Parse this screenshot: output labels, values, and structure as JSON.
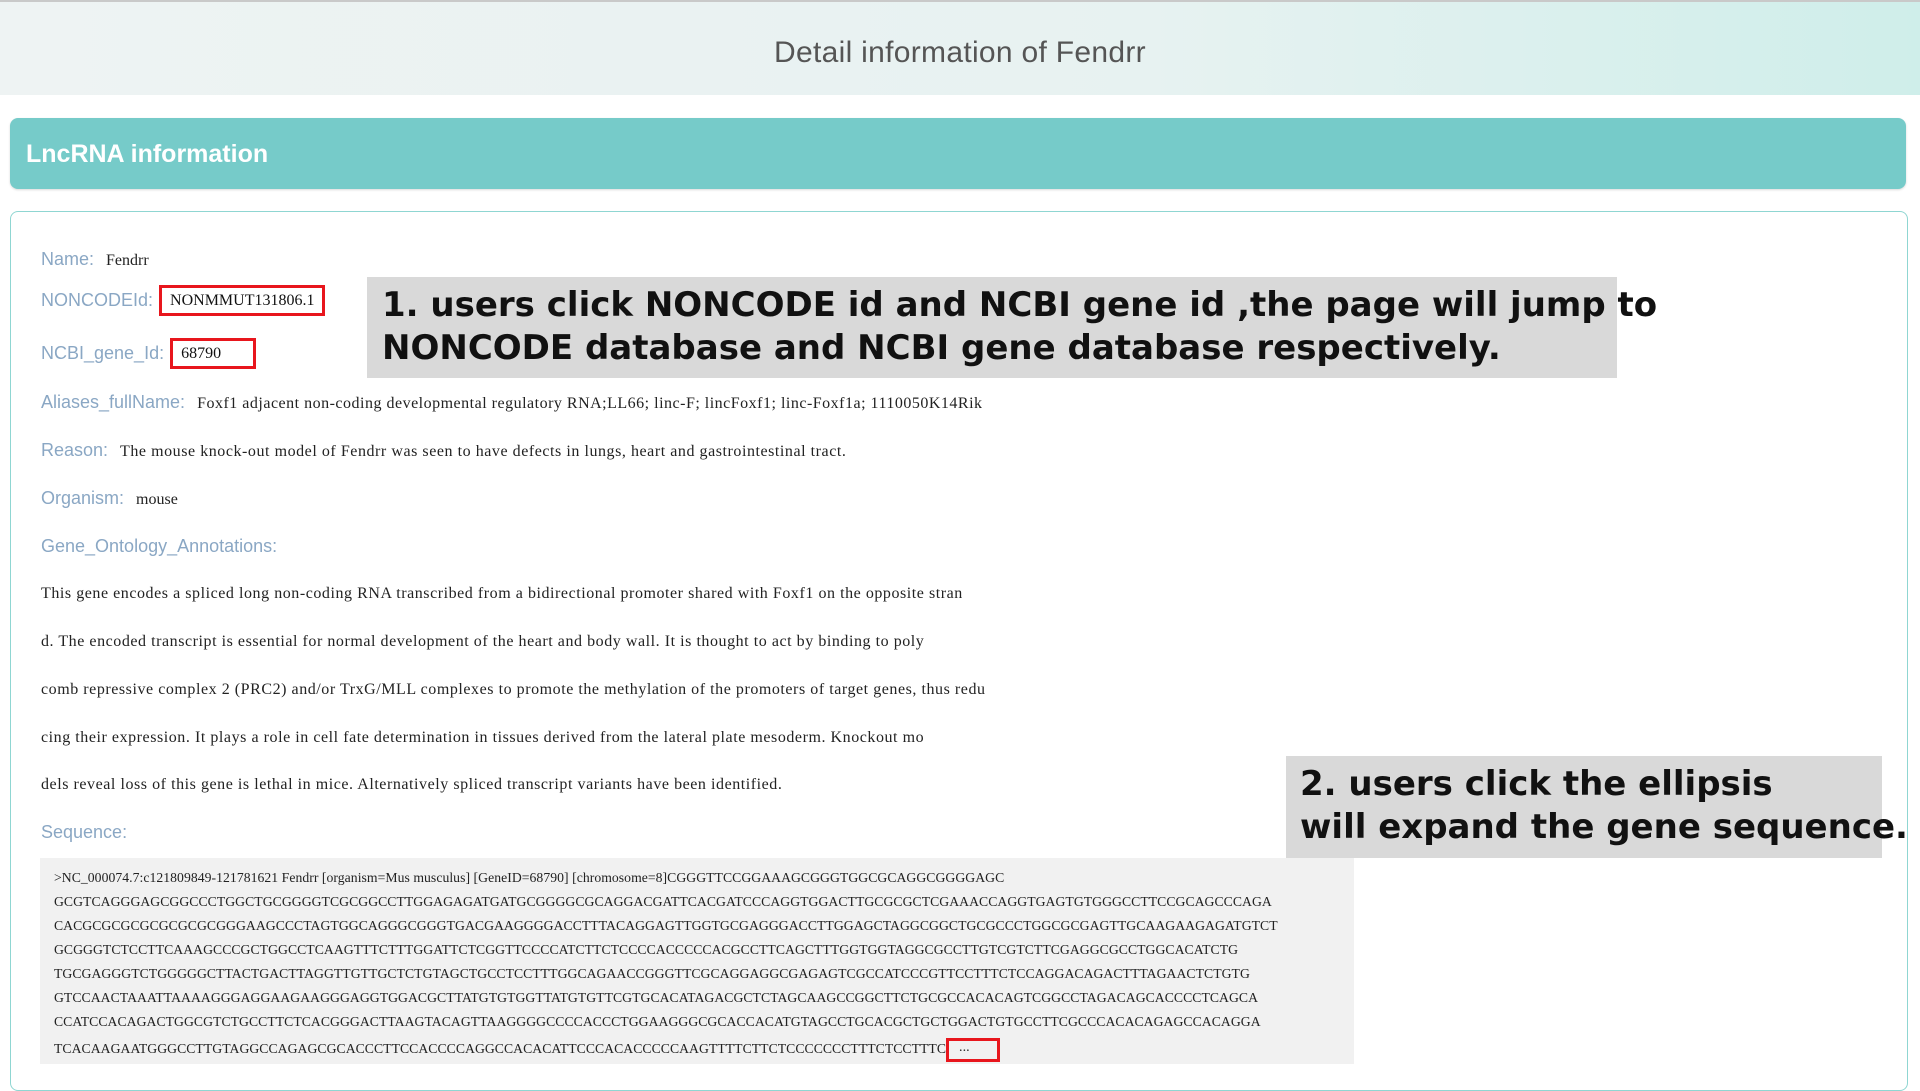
{
  "header": {
    "title": "Detail information of Fendrr"
  },
  "section": {
    "title": "LncRNA information"
  },
  "fields": {
    "name_label": "Name:",
    "name_value": "Fendrr",
    "noncode_label": "NONCODEId:",
    "noncode_value": "NONMMUT131806.1",
    "ncbi_label": "NCBI_gene_Id:",
    "ncbi_value": "68790",
    "aliases_label": "Aliases_fullName:",
    "aliases_value": "Foxf1 adjacent non-coding developmental regulatory RNA;LL66; linc-F; lincFoxf1; linc-Foxf1a; 1110050K14Rik",
    "reason_label": "Reason:",
    "reason_value": "The mouse knock-out model of Fendrr was seen to have defects in lungs, heart and gastrointestinal tract.",
    "organism_label": "Organism:",
    "organism_value": "mouse",
    "go_label": "Gene_Ontology_Annotations:",
    "go_lines": [
      "This gene encodes a spliced long non-coding RNA transcribed from a bidirectional promoter shared with Foxf1 on the opposite stran",
      "d. The encoded transcript is essential for normal development of the heart and body wall. It is thought to act by binding to poly",
      "comb repressive complex 2 (PRC2) and/or TrxG/MLL complexes to promote the methylation of the promoters of target genes, thus redu",
      "cing their expression. It plays a role in cell fate determination in tissues derived from the lateral plate mesoderm. Knockout mo",
      "dels reveal loss of this gene is lethal in mice. Alternatively spliced transcript variants have been identified."
    ],
    "sequence_label": "Sequence:"
  },
  "sequence": {
    "lines": [
      ">NC_000074.7:c121809849-121781621 Fendrr [organism=Mus musculus] [GeneID=68790] [chromosome=8]CGGGTTCCGGAAAGCGGGTGGCGCAGGCGGGGAGC",
      "GCGTCAGGGAGCGGCCCTGGCTGCGGGGTCGCGGCCTTGGAGAGATGATGCGGGGCGCAGGACGATTCACGATCCCAGGTGGACTTGCGCGCTCGAAACCAGGTGAGTGTGGGCCTTCCGCAGCCCAGA",
      "CACGCGCGCGCGCGCGCGGGAAGCCCTAGTGGCAGGGCGGGTGACGAAGGGGACCTTTACAGGAGTTGGTGCGAGGGACCTTGGAGCTAGGCGGCTGCGCCCTGGCGCGAGTTGCAAGAAGAGATGTCT",
      "GCGGGTCTCCTTCAAAGCCCGCTGGCCTCAAGTTTCTTTGGATTCTCGGTTCCCCATCTTCTCCCCACCCCCACGCCTTCAGCTTTGGTGGTAGGCGCCTTGTCGTCTTCGAGGCGCCTGGCACATCTG",
      "TGCGAGGGTCTGGGGGCTTACTGACTTAGGTTGTTGCTCTGTAGCTGCCTCCTTTGGCAGAACCGGGTTCGCAGGAGGCGAGAGTCGCCATCCCGTTCCTTTCTCCAGGACAGACTTTAGAACTCTGTG",
      "GTCCAACTAAATTAAAAGGGAGGAAGAAGGGAGGTGGACGCTTATGTGTGGTTATGTGTTCGTGCACATAGACGCTCTAGCAAGCCGGCTTCTGCGCCACACAGTCGGCCTAGACAGCACCCCTCAGCA",
      "CCATCCACAGACTGGCGTCTGCCTTCTCACGGGACTTAAGTACAGTTAAGGGGCCCCACCCTGGAAGGGCGCACCACATGTAGCCTGCACGCTGCTGGACTGTGCCTTCGCCCACACAGAGCCACAGGA",
      "TCACAAGAATGGGCCTTGTAGGCCAGAGCGCACCCTTCCACCCCAGGCCACACATTCCCACACCCCCAAGTTTTCTTCTCCCCCCCTTTCTCCTTTC"
    ],
    "ellipsis": "..."
  },
  "callouts": {
    "first": [
      "1. users click NONCODE id and NCBI gene id ,the page will jump to",
      "NONCODE database and NCBI gene database respectively."
    ],
    "second": [
      "2. users click the ellipsis",
      "will expand the gene sequence."
    ]
  },
  "colors": {
    "accent": "#76cbc9",
    "label": "#8aa7c4",
    "highlight_border": "#e8161d",
    "callout_bg": "#d9d9d9"
  }
}
